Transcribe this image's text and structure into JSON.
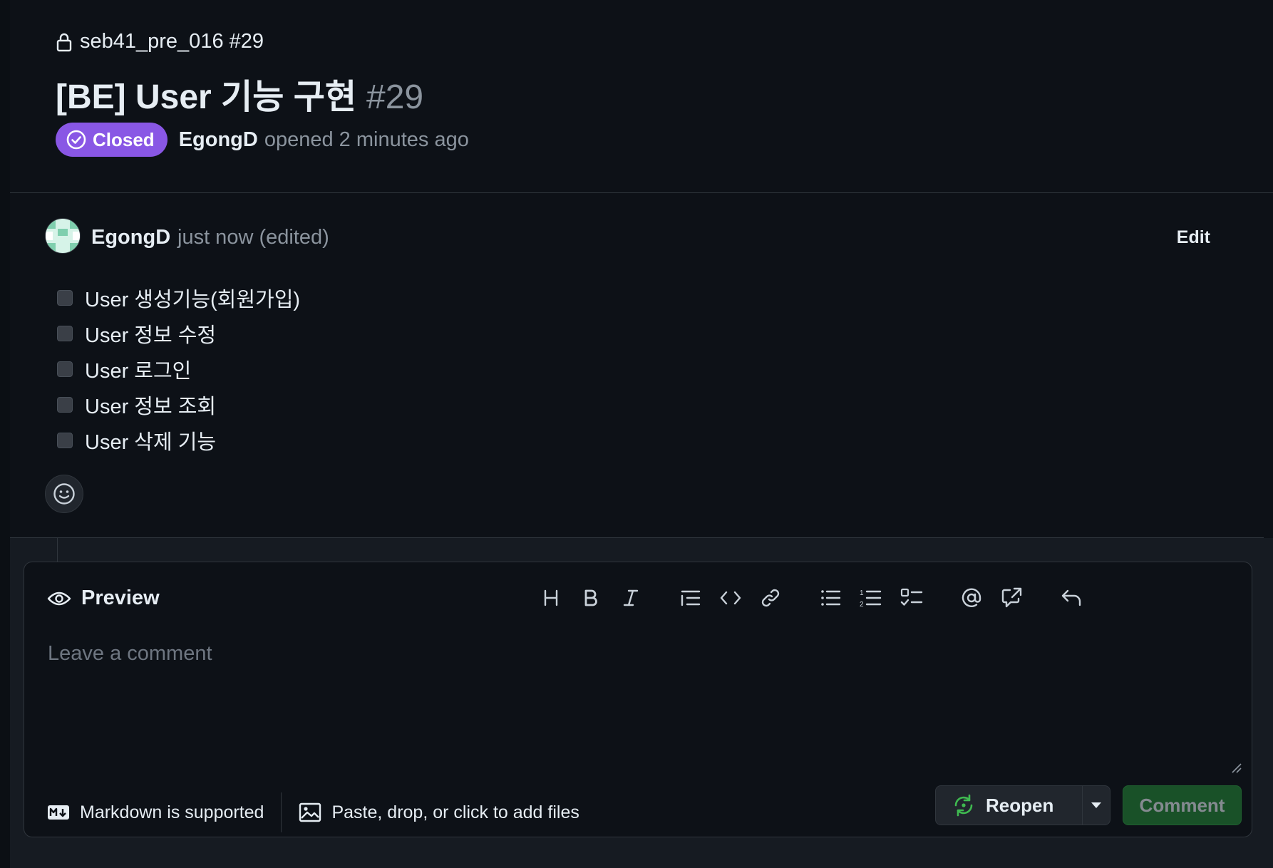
{
  "header": {
    "repo": "seb41_pre_016 #29",
    "title": "[BE] User 기능 구현",
    "title_number": "#29",
    "status": "Closed",
    "author": "EgongD",
    "opened_text": "opened 2 minutes ago"
  },
  "comment": {
    "author": "EgongD",
    "time": "just now (edited)",
    "edit_label": "Edit",
    "tasks": [
      "User 생성기능(회원가입)",
      "User 정보 수정",
      "User 로그인",
      "User 정보 조회",
      "User 삭제 기능"
    ]
  },
  "editor": {
    "preview_label": "Preview",
    "placeholder": "Leave a comment",
    "markdown_label": "Markdown is supported",
    "files_label": "Paste, drop, or click to add files",
    "reopen_label": "Reopen",
    "comment_label": "Comment"
  },
  "colors": {
    "background": "#0d1117",
    "closed_badge": "#8957e5",
    "reopen_icon": "#3fb950",
    "comment_button": "#238636"
  },
  "icons": {
    "repo": "lock-icon",
    "status": "check-circle-icon",
    "preview": "eye-icon",
    "toolbar": [
      "heading-icon",
      "bold-icon",
      "italic-icon",
      "quote-icon",
      "code-icon",
      "link-icon",
      "bullet-list-icon",
      "numbered-list-icon",
      "task-list-icon",
      "mention-icon",
      "reference-icon",
      "undo-icon"
    ]
  }
}
